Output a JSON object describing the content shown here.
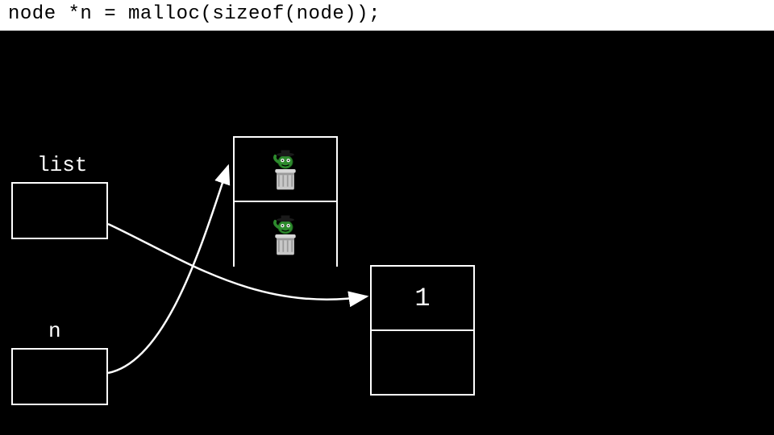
{
  "code": "node *n = malloc(sizeof(node));",
  "labels": {
    "list": "list",
    "n": "n"
  },
  "node1": {
    "value": "1",
    "next": ""
  },
  "garbage_icon": "garbage-value-icon",
  "colors": {
    "bg": "#000000",
    "fg": "#ffffff",
    "code_bg": "#ffffff",
    "code_fg": "#000000"
  }
}
